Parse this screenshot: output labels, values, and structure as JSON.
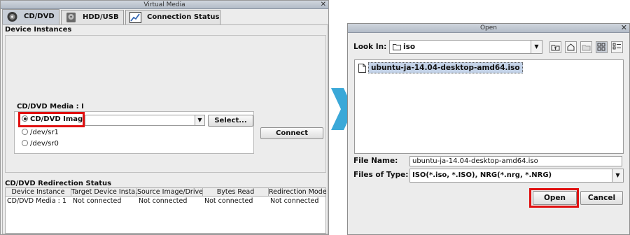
{
  "virtual_media": {
    "title": "Virtual Media",
    "close_glyph": "✕",
    "tabs": [
      {
        "label": "CD/DVD",
        "icon": "cd-icon"
      },
      {
        "label": "HDD/USB",
        "icon": "hdd-icon"
      },
      {
        "label": "Connection Status",
        "icon": "chart-icon"
      }
    ],
    "device_instances_label": "Device Instances",
    "media_label": "CD/DVD Media : I",
    "options": [
      {
        "label": "CD/DVD Image",
        "checked": true
      },
      {
        "label": "/dev/sr1",
        "checked": false
      },
      {
        "label": "/dev/sr0",
        "checked": false
      }
    ],
    "image_path_value": "",
    "combo_arrow": "▼",
    "select_label": "Select...",
    "connect_label": "Connect",
    "redirection_status_label": "CD/DVD Redirection Status",
    "table": {
      "headers": [
        "Device Instance",
        "Target Device Insta...",
        "Source Image/Drive",
        "Bytes Read",
        "Redirection Mode"
      ],
      "rows": [
        [
          "CD/DVD Media :  1",
          "Not connected",
          "Not connected",
          "Not connected",
          "Not connected"
        ]
      ]
    }
  },
  "open_dialog": {
    "title": "Open",
    "close_glyph": "✕",
    "look_in_label": "Look In:",
    "look_in_value": "iso",
    "combo_arrow": "▼",
    "files": [
      "ubuntu-ja-14.04-desktop-amd64.iso"
    ],
    "file_name_label": "File Name:",
    "file_name_value": "ubuntu-ja-14.04-desktop-amd64.iso",
    "files_of_type_label": "Files of Type:",
    "files_of_type_value": "ISO(*.iso, *.ISO), NRG(*.nrg, *.NRG)",
    "open_label": "Open",
    "cancel_label": "Cancel"
  },
  "colors": {
    "highlight": "#e01010",
    "arrow": "#3aa8d8",
    "selection": "#c4d3e8"
  }
}
